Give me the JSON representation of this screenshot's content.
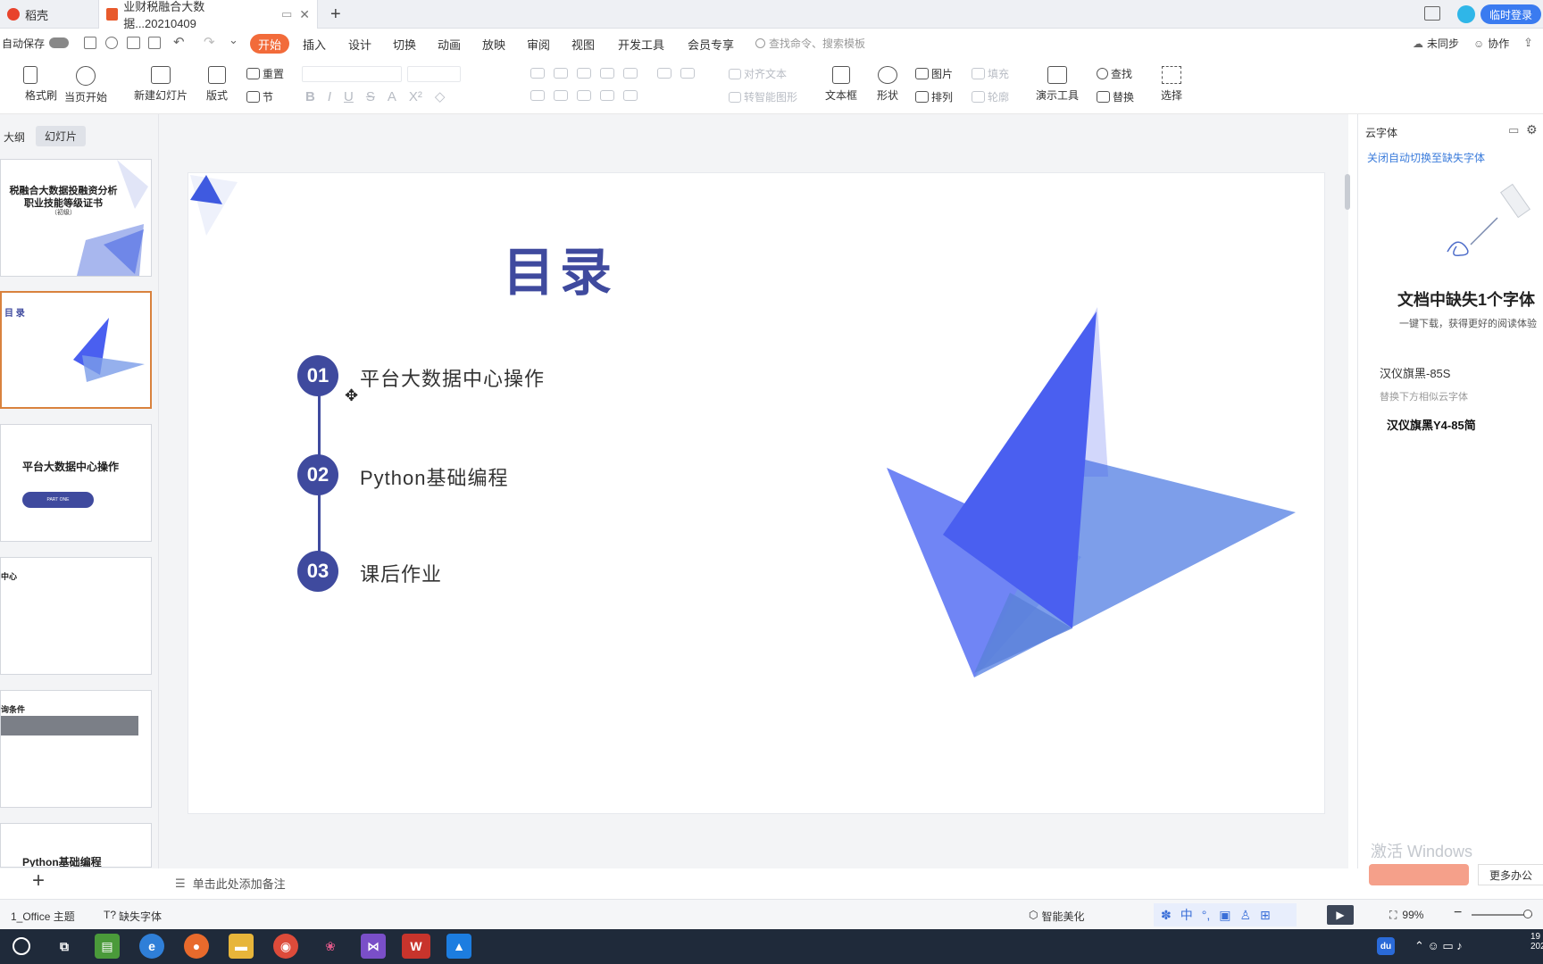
{
  "tabs": {
    "home_tab": "稻壳",
    "doc_tab": "业财税融合大数据...20210409",
    "new_tab": "+",
    "user_badge": "临时登录"
  },
  "quick": {
    "autosave": "自动保存"
  },
  "menu": [
    "开始",
    "插入",
    "设计",
    "切换",
    "动画",
    "放映",
    "审阅",
    "视图",
    "开发工具",
    "会员专享"
  ],
  "search_placeholder": "查找命令、搜索模板",
  "topright": {
    "sync": "未同步",
    "collab": "协作"
  },
  "ribbon": {
    "format_painter": "格式刷",
    "from_current": "当页开始",
    "new_slide": "新建幻灯片",
    "layout": "版式",
    "reset": "重置",
    "section": "节",
    "align_text": "对齐文本",
    "smart_shape": "转智能图形",
    "textbox": "文本框",
    "shape": "形状",
    "picture": "图片",
    "arrange": "排列",
    "fill": "填充",
    "outline": "轮廓",
    "present_tools": "演示工具",
    "find": "查找",
    "replace": "替换",
    "select": "选择"
  },
  "panel_tabs": {
    "outline": "大纲",
    "slides": "幻灯片"
  },
  "thumbs": {
    "t1_title": "税融合大数据投融资分析",
    "t1_sub": "职业技能等级证书",
    "t1_level": "（初级）",
    "t2_title": "目 录",
    "t3_title": "平台大数据中心操作",
    "t3_btn": "PART ONE",
    "t4_title": "中心",
    "t5_title": "询条件",
    "t6_title": "Python基础编程"
  },
  "slide": {
    "title": "目录",
    "items": [
      {
        "num": "01",
        "text": "平台大数据中心操作"
      },
      {
        "num": "02",
        "text": "Python基础编程"
      },
      {
        "num": "03",
        "text": "课后作业"
      }
    ]
  },
  "notes_placeholder": "单击此处添加备注",
  "right": {
    "header": "云字体",
    "auto_switch": "关闭自动切换至缺失字体",
    "missing_title": "文档中缺失1个字体",
    "missing_sub": "一键下载，获得更好的阅读体验",
    "font_name": "汉仪旗黑-85S",
    "replace_hint": "替换下方相似云字体",
    "font_alt": "汉仪旗黑Y4-85简",
    "activate": "激活 Windows",
    "more": "更多办公"
  },
  "status": {
    "theme": "1_Office 主题",
    "missing_font": "缺失字体",
    "beautify": "智能美化",
    "zoom": "99%",
    "ime": "中"
  },
  "colors": {
    "accent": "#3f4a9e",
    "primary_btn": "#f26b3a",
    "link": "#3b7cdb",
    "tri_dark": "#4a5ff0",
    "tri_light": "#6f93e8"
  }
}
